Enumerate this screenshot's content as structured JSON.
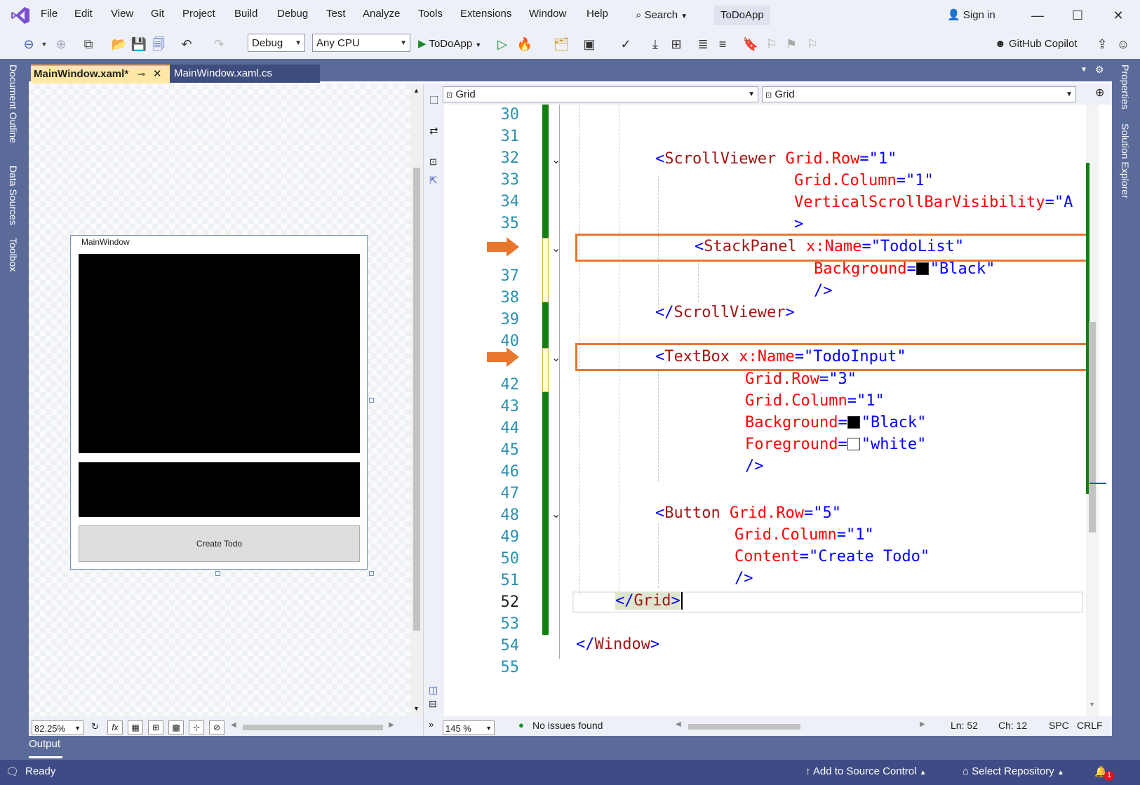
{
  "menu": [
    "File",
    "Edit",
    "View",
    "Git",
    "Project",
    "Build",
    "Debug",
    "Test",
    "Analyze",
    "Tools",
    "Extensions",
    "Window",
    "Help"
  ],
  "search_label": "Search",
  "app_name": "ToDoApp",
  "sign_in": "Sign in",
  "toolbar": {
    "config": "Debug",
    "platform": "Any CPU",
    "run_target": "ToDoApp",
    "copilot": "GitHub Copilot"
  },
  "left_tabs": [
    "Document Outline",
    "Data Sources",
    "Toolbox"
  ],
  "right_tabs": [
    "Properties",
    "Solution Explorer"
  ],
  "tabs": [
    {
      "label": "MainWindow.xaml*"
    },
    {
      "label": "MainWindow.xaml.cs"
    }
  ],
  "designer": {
    "window_title": "MainWindow",
    "button_label": "Create Todo",
    "zoom": "82.25%",
    "fx": "fx"
  },
  "editor": {
    "nav_left": "Grid",
    "nav_right": "Grid",
    "zoom": "145 %",
    "status": "No issues found",
    "ln": "Ln: 52",
    "ch": "Ch: 12",
    "spc": "SPC",
    "crlf": "CRLF",
    "line_numbers": [
      "30",
      "31",
      "32",
      "33",
      "34",
      "35",
      "",
      "37",
      "38",
      "39",
      "40",
      "",
      "42",
      "43",
      "44",
      "45",
      "46",
      "47",
      "48",
      "49",
      "50",
      "51",
      "52",
      "53",
      "54",
      "55"
    ],
    "colors": {
      "tag": "#0000ff",
      "name": "#a31515",
      "attr": "#ff0000",
      "highlight": "#e8772e",
      "gutter": "#108010"
    }
  },
  "code": {
    "l32_tag": "ScrollViewer",
    "l32_attr": "Grid.Row",
    "l32_val": "\"1\"",
    "l33_attr": "Grid.Column",
    "l33_val": "\"1\"",
    "l34_attr": "VerticalScrollBarVisibility",
    "l34_val": "\"A",
    "l36_tag": "StackPanel",
    "l36_attr": "x:Name",
    "l36_val": "\"TodoList\"",
    "l37_attr": "Background",
    "l37_val": "\"Black\"",
    "l39_tag": "ScrollViewer",
    "l41_tag": "TextBox",
    "l41_attr": "x:Name",
    "l41_val": "\"TodoInput\"",
    "l42_attr": "Grid.Row",
    "l42_val": "\"3\"",
    "l43_attr": "Grid.Column",
    "l43_val": "\"1\"",
    "l44_attr": "Background",
    "l44_val": "\"Black\"",
    "l45_attr": "Foreground",
    "l45_val": "\"white\"",
    "l48_tag": "Button",
    "l48_attr": "Grid.Row",
    "l48_val": "\"5\"",
    "l49_attr": "Grid.Column",
    "l49_val": "\"1\"",
    "l50_attr": "Content",
    "l50_val": "\"Create Todo\"",
    "l52_tag": "Grid",
    "l54_tag": "Window"
  },
  "output_label": "Output",
  "status": {
    "ready": "Ready",
    "source_control": "Add to Source Control",
    "repository": "Select Repository",
    "notifications": "1"
  }
}
